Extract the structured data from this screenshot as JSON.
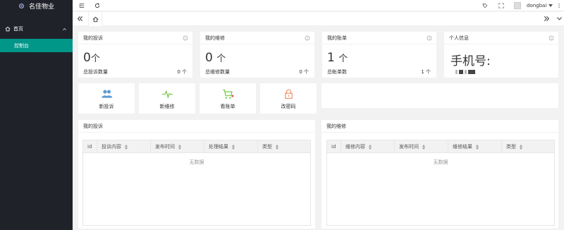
{
  "app": {
    "title": "名佳物业"
  },
  "sidebar": {
    "group_label": "首页",
    "items": [
      {
        "label": "控制台",
        "active": true
      }
    ]
  },
  "header": {
    "username": "dongbai"
  },
  "stats": [
    {
      "title": "我的投诉",
      "value": "0",
      "unit": "个",
      "foot_label": "总投诉数量",
      "foot_value": "0 个"
    },
    {
      "title": "我的维修",
      "value": "0",
      "unit": "个",
      "foot_label": "总维修数量",
      "foot_value": "0 个"
    },
    {
      "title": "我的账单",
      "value": "1",
      "unit": "个",
      "foot_label": "总帐单数",
      "foot_value": "1 个"
    }
  ],
  "profile": {
    "title": "个人信息",
    "phone_label": "手机号:"
  },
  "actions": [
    {
      "label": "新投诉",
      "icon": "users-icon",
      "color": "#5b9bd5"
    },
    {
      "label": "新维修",
      "icon": "heartbeat-icon",
      "color": "#67c23a"
    },
    {
      "label": "看账单",
      "icon": "cart-icon",
      "color": "#67c23a"
    },
    {
      "label": "改密码",
      "icon": "lock-icon",
      "color": "#f08a5d"
    }
  ],
  "complaints": {
    "title": "我的投诉",
    "columns": [
      "id",
      "投诉内容",
      "发布时间",
      "处理结果",
      "类型"
    ],
    "empty_text": "无数据"
  },
  "repairs": {
    "title": "我的维修",
    "columns": [
      "id",
      "维修内容",
      "发布时间",
      "维修结果",
      "类型"
    ],
    "empty_text": "无数据"
  },
  "colors": {
    "sidebar_bg": "#20222a",
    "accent": "#009688",
    "page_bg": "#f2f2f2"
  }
}
